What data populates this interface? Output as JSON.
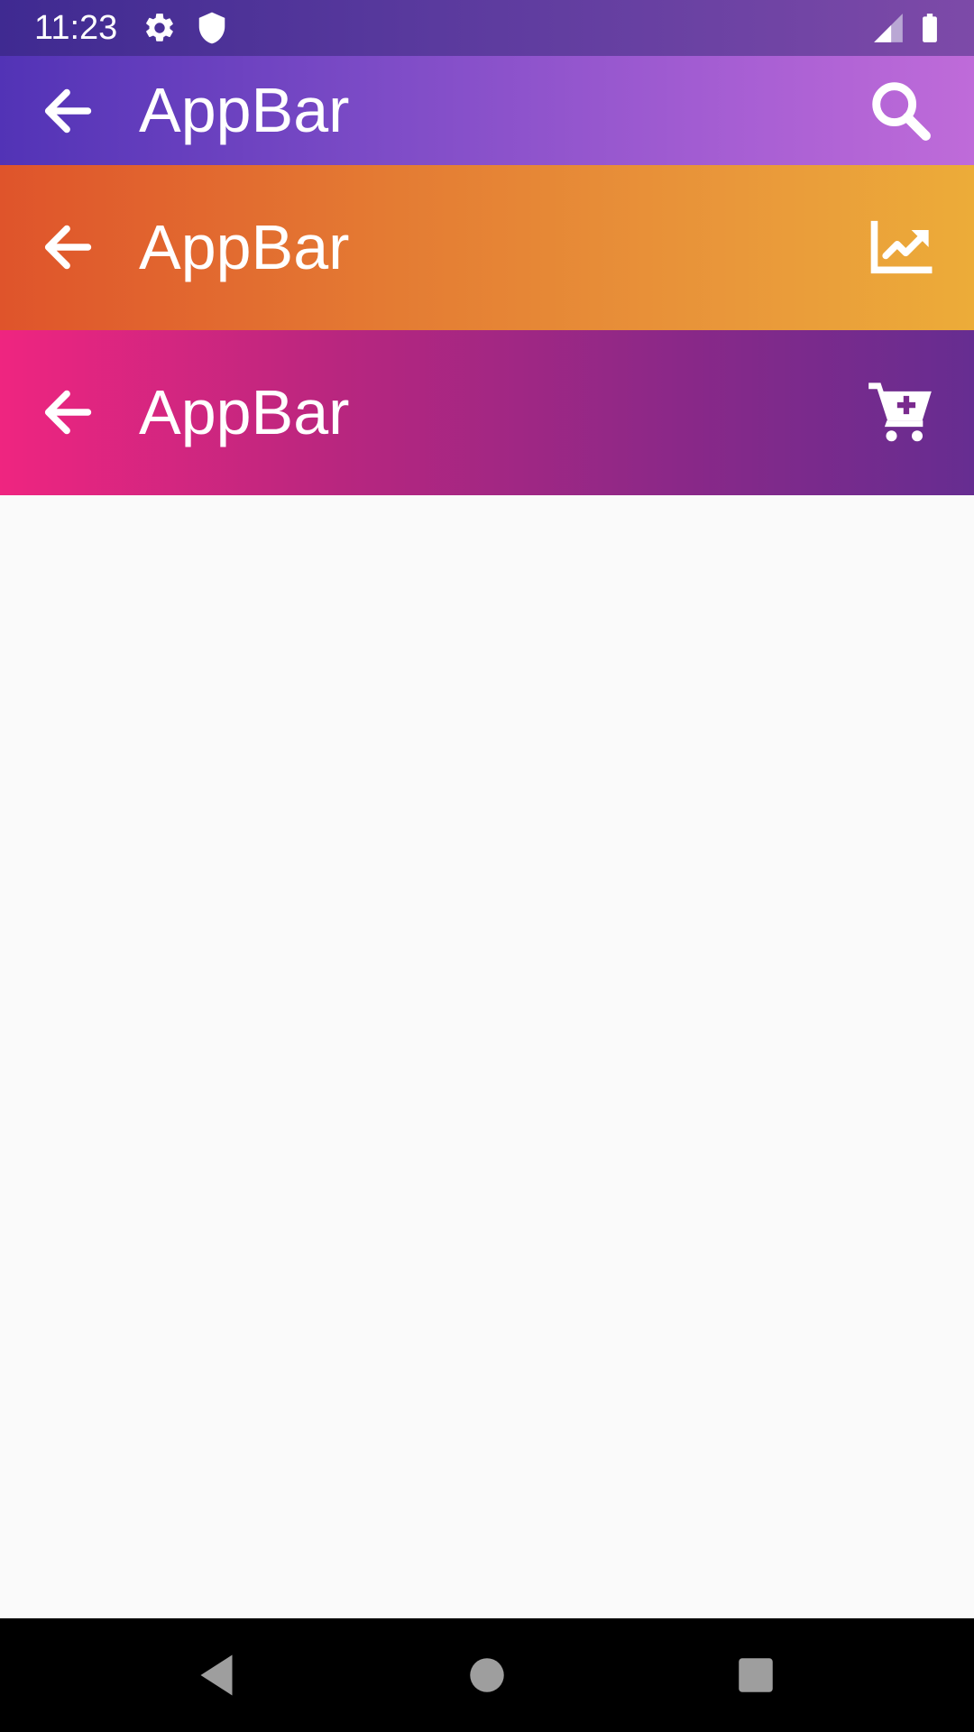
{
  "status_bar": {
    "time": "11:23",
    "icons": [
      "settings-icon",
      "shield-icon",
      "signal-icon",
      "battery-icon"
    ]
  },
  "app_bars": [
    {
      "title": "AppBar",
      "leading_icon": "arrow-back-icon",
      "action_icon": "search-icon",
      "gradient": [
        "#5233b6",
        "#bf6bd9"
      ]
    },
    {
      "title": "AppBar",
      "leading_icon": "arrow-back-icon",
      "action_icon": "trending-chart-icon",
      "gradient": [
        "#df542b",
        "#ecac39"
      ]
    },
    {
      "title": "AppBar",
      "leading_icon": "arrow-back-icon",
      "action_icon": "add-shopping-cart-icon",
      "gradient": [
        "#ef2580",
        "#662d91"
      ]
    }
  ],
  "nav_bar": {
    "buttons": [
      "back-triangle-icon",
      "home-circle-icon",
      "recents-square-icon"
    ]
  }
}
